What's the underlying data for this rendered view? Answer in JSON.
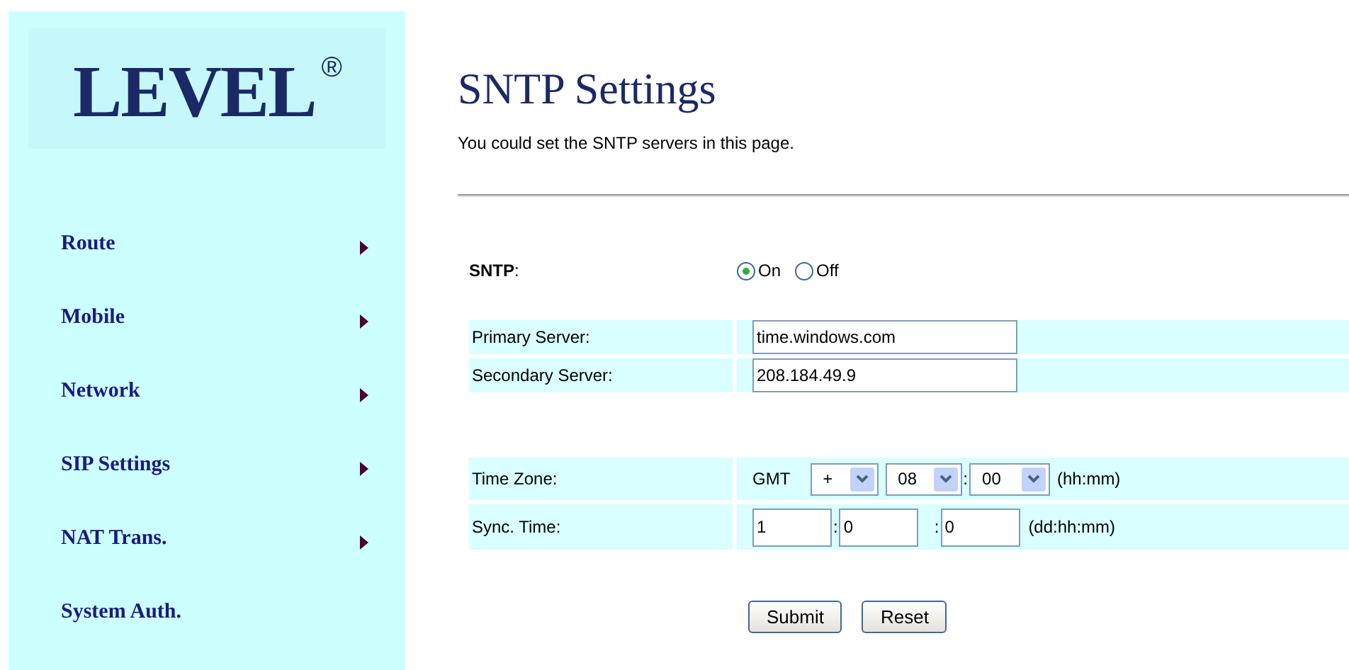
{
  "logo": {
    "text": "LEVEL",
    "mark": "®"
  },
  "sidebar": {
    "items": [
      {
        "label": "Route",
        "has_submenu": true
      },
      {
        "label": "Mobile",
        "has_submenu": true
      },
      {
        "label": "Network",
        "has_submenu": true
      },
      {
        "label": "SIP Settings",
        "has_submenu": true
      },
      {
        "label": "NAT Trans.",
        "has_submenu": true
      },
      {
        "label": "System Auth.",
        "has_submenu": false
      }
    ]
  },
  "page": {
    "title": "SNTP Settings",
    "subtitle": "You could set the SNTP servers in this page."
  },
  "sntp": {
    "label": "SNTP",
    "colon": ":",
    "options": [
      {
        "label": "On",
        "selected": true
      },
      {
        "label": "Off",
        "selected": false
      }
    ]
  },
  "servers": [
    {
      "label": "Primary Server:",
      "value": "time.windows.com"
    },
    {
      "label": "Secondary Server:",
      "value": "208.184.49.9"
    }
  ],
  "time_zone": {
    "label": "Time Zone:",
    "prefix": "GMT",
    "sign": "+",
    "hours": "08",
    "separator": ":",
    "minutes": "00",
    "unit": "(hh:mm)"
  },
  "sync_time": {
    "label": "Sync. Time:",
    "days": "1",
    "hours": "0",
    "minutes": "0",
    "separators": [
      ":",
      ":"
    ],
    "unit": "(dd:hh:mm)"
  },
  "buttons": [
    "Submit",
    "Reset"
  ]
}
